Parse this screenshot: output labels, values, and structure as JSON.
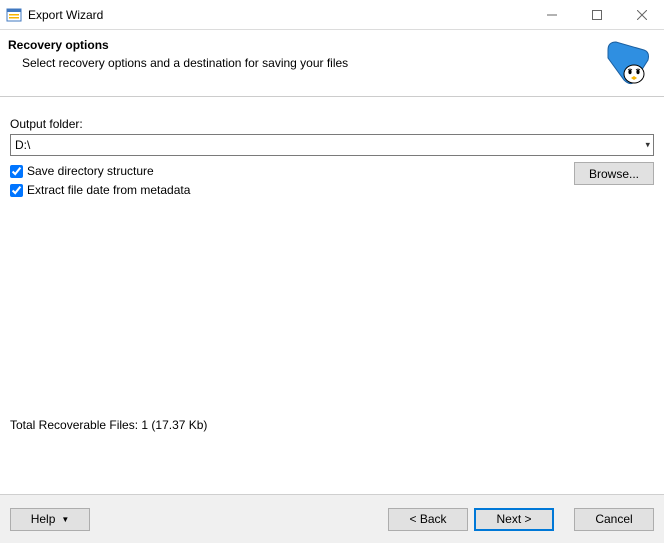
{
  "window": {
    "title": "Export Wizard"
  },
  "header": {
    "heading": "Recovery options",
    "subheading": "Select recovery options and a destination for saving your files"
  },
  "form": {
    "output_folder_label": "Output folder:",
    "output_folder_value": "D:\\",
    "save_directory_structure_label": "Save directory structure",
    "extract_file_date_label": "Extract file date from metadata",
    "browse_label": "Browse..."
  },
  "status": {
    "recoverable": "Total Recoverable Files: 1 (17.37 Kb)"
  },
  "buttons": {
    "help": "Help",
    "back": "< Back",
    "next": "Next >",
    "cancel": "Cancel"
  }
}
